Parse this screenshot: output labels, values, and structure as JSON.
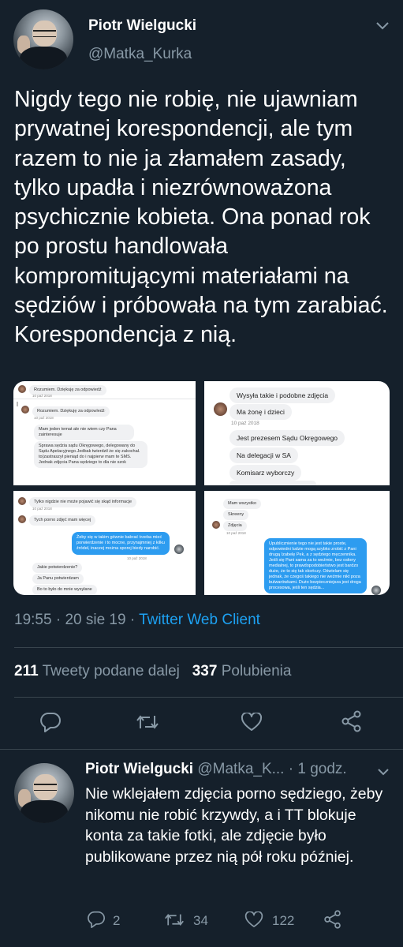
{
  "tweet": {
    "author_name": "Piotr Wielgucki",
    "author_handle": "@Matka_Kurka",
    "text": "Nigdy tego nie robię, nie ujawniam prywatnej korespondencji, ale tym razem to nie ja złamałem zasady, tylko upadła i niezrównoważona psychicznie kobieta. Ona ponad rok po prostu handlowała kompromitującymi materiałami na sędziów i próbowała na tym zarabiać. Korespondencja z nią.",
    "time": "19:55",
    "date": "20 sie 19",
    "separator": "·",
    "client": "Twitter Web Client",
    "retweets_count": "211",
    "retweets_label": "Tweety podane dalej",
    "likes_count": "337",
    "likes_label": "Polubienia"
  },
  "media": {
    "img1": {
      "msg1": "Rozumiem. Dziękuję za odpowiedź",
      "ts1": "10 paź 2018",
      "msg2": "Rozumiem. Dziękuję za odpowiedź",
      "ts2": "10 paź 2018",
      "msg3": "Mam jeden temat ale nie wiem czy Pana zainteresuje",
      "msg4": "Sprawa sędzia sądu Okręgowego, delegowany do Sądu Apelacyjnego.Jedbak twierdził że się zakochał. to(zastraszył pieniąd do i najpierw mam te SMS. Jednak zdjęcia Pana sędziego to dla nie szok"
    },
    "img2": {
      "msg1": "Wysyła takie i podobne zdjęcia",
      "msg2": "Ma żonę i dzieci",
      "ts1": "10 paź 2018",
      "msg3": "Jest prezesem Sądu Okręgowego",
      "msg4": "Na delegacji w SA",
      "msg5": "Komisarz wyborczy"
    },
    "img3": {
      "msg1": "Tylko nigdzie nie może pojawić się skąd informacje",
      "ts1": "10 paź 2018",
      "msg2": "Tych porno zdjęć mam więcej",
      "msg3": "Żeby się w takim gównie babrać trzeba mieć porwierdzenie i to mocne, przynajmniej z kilku źródeł, inaczej można sporej biedy narobić.",
      "ts2": "10 paź 2018",
      "msg4": "Jakie potwierdzenie?",
      "msg5": "Ja Panu potwierdzam",
      "msg6": "Bo to było do mnie wysyłane"
    },
    "img4": {
      "msg1": "Mam wszystko",
      "msg2": "Skreeny",
      "msg3": "Zdjęcia",
      "ts1": "10 paź 2018",
      "msg4": "Upublicznienie tego nie jest takie proste, odpowiedni ludzie mogą szybko zrobić z Pani drugą Izabelę Pek, a z sędziego męczennika. Jeśli się Pani sama za to weźmie, bez osłony medialnej, to prawdopodobieństwo jest bardzo duże, że to się tak skończy. Oświelam się jednak, że czegoś takiego nie weźmie nikt poza bulwarówkami. Dużo bezpieczniejsza jest droga procesowa, jeśli ten sędzia..."
    }
  },
  "reply": {
    "author_name": "Piotr Wielgucki",
    "author_handle": "@Matka_K...",
    "time_ago": "· 1 godz.",
    "text": "Nie wklejałem zdjęcia porno sędziego, żeby nikomu nie robić krzywdy, a i TT blokuje konta za takie fotki, ale zdjęcie było publikowane przez nią pół roku później.",
    "replies": "2",
    "retweets": "34",
    "likes": "122"
  },
  "colors": {
    "background": "#15202b",
    "secondary_text": "#8899a6",
    "accent": "#1da1f2",
    "divider": "#38444d"
  },
  "icons": [
    "chevron-down-icon",
    "reply-icon",
    "retweet-icon",
    "like-icon",
    "share-icon"
  ]
}
